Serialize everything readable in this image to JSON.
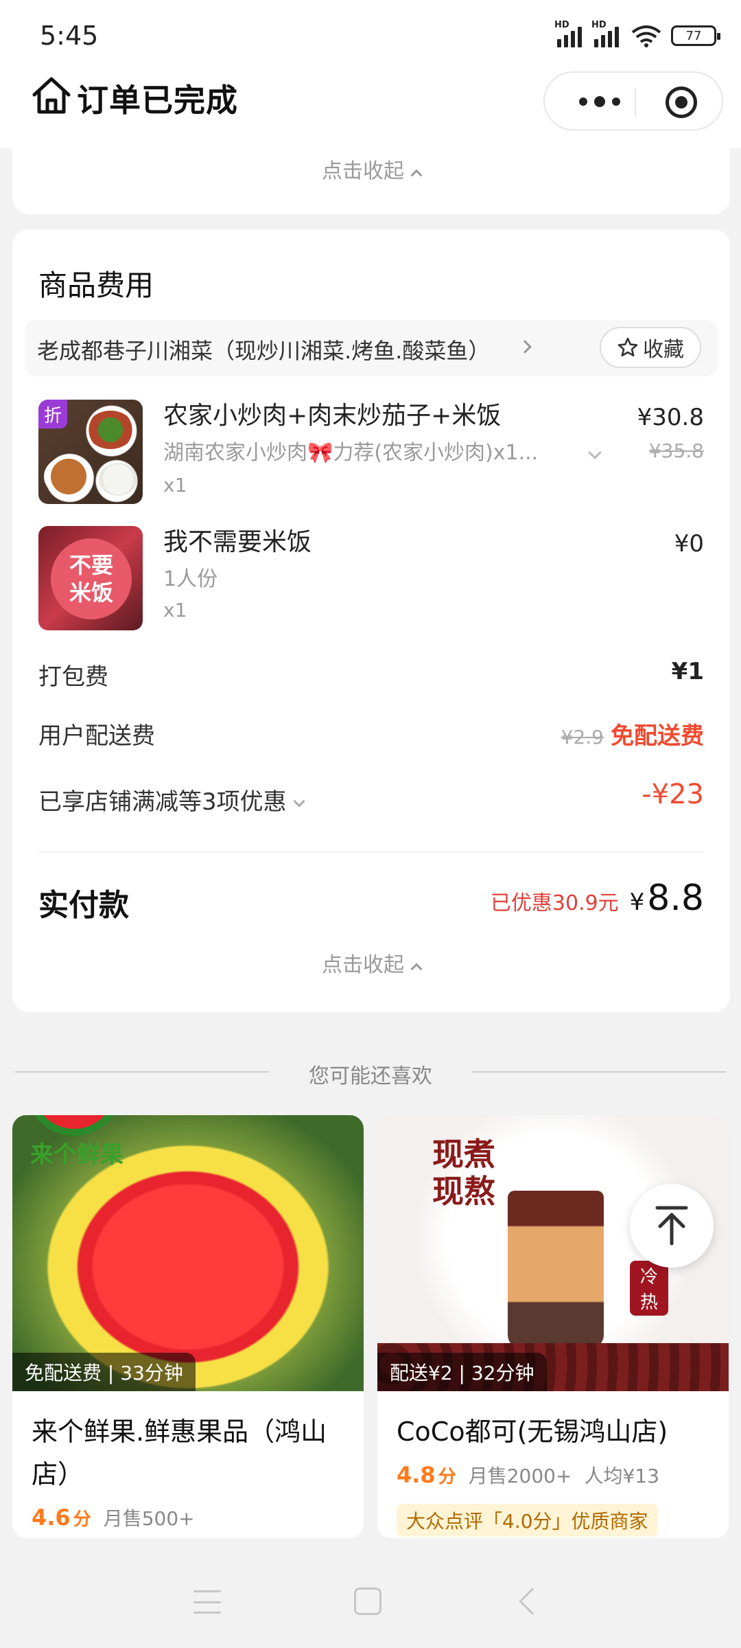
{
  "status_bar": {
    "time": "5:45",
    "hd1": "HD",
    "hd2": "HD",
    "battery": "77"
  },
  "header": {
    "title": "订单已完成",
    "home_icon": "home-icon",
    "more_icon": "more-dots-icon",
    "close_icon": "target-icon"
  },
  "top_card": {
    "collapse_label": "点击收起"
  },
  "fee_card": {
    "title": "商品费用",
    "shop_name": "老成都巷子川湘菜（现炒川湘菜.烤鱼.酸菜鱼）",
    "favorite_label": "收藏",
    "items": [
      {
        "badge": "折",
        "name": "农家小炒肉+肉末炒茄子+米饭",
        "spec": "湖南农家小炒肉🎀力荐(农家小炒肉)x1...",
        "qty": "x1",
        "price": "¥30.8",
        "original_price": "¥35.8"
      },
      {
        "thumb_text_1": "不要",
        "thumb_text_2": "米饭",
        "name": "我不需要米饭",
        "spec": "1人份",
        "qty": "x1",
        "price": "¥0"
      }
    ],
    "packing_fee_label": "打包费",
    "packing_fee": "¥1",
    "delivery_fee_label": "用户配送费",
    "delivery_fee_original": "¥2.9",
    "delivery_fee_value": "免配送费",
    "discount_label": "已享店铺满减等3项优惠",
    "discount_value": "-¥23",
    "paid_label": "实付款",
    "saved_text": "已优惠30.9元",
    "currency": "¥",
    "paid_amount": "8.8",
    "collapse_label": "点击收起"
  },
  "recommend": {
    "title": "您可能还喜欢",
    "cards": [
      {
        "brand": "来个鲜果",
        "delivery": "免配送费 | 33分钟",
        "name": "来个鲜果.鲜惠果品（鸿山店）",
        "score": "4.6",
        "score_unit": "分",
        "sales": "月售500+"
      },
      {
        "img_text_1": "现煮",
        "img_text_2": "现熬",
        "cold": "冷",
        "hot": "热",
        "delivery": "配送¥2 | 32分钟",
        "name": "CoCo都可(无锡鸿山店)",
        "score": "4.8",
        "score_unit": "分",
        "sales": "月售2000+",
        "avg": "人均¥13",
        "tag": "大众点评「4.0分」优质商家"
      }
    ]
  },
  "colors": {
    "accent_red": "#f04a2f",
    "score_orange": "#ff7a1a",
    "tag_bg": "#fff4d6"
  }
}
